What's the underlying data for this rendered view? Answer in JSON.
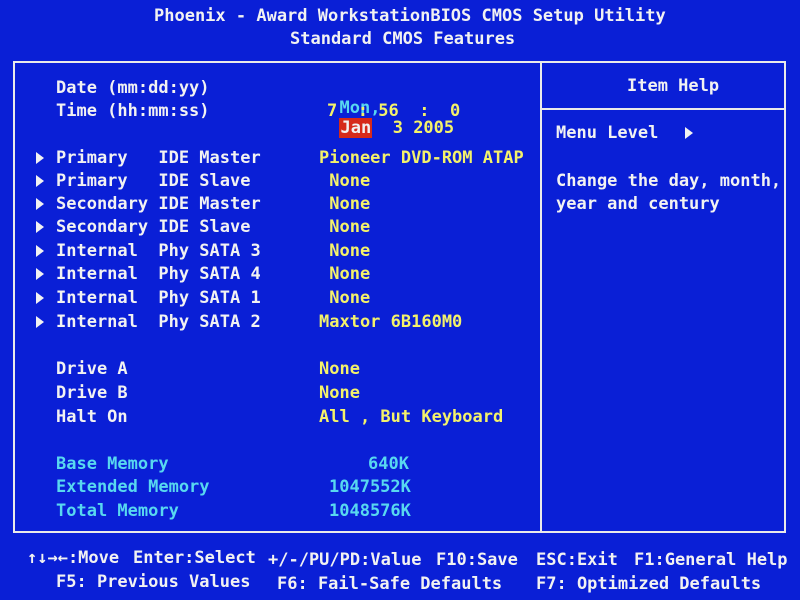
{
  "header": {
    "title": "Phoenix - Award WorkstationBIOS CMOS Setup Utility",
    "subtitle": "Standard CMOS Features"
  },
  "datetime": {
    "date_label": "Date (mm:dd:yy)",
    "time_label": "Time (hh:mm:ss)",
    "day": "Mon,",
    "month": "Jan",
    "day_num": "3",
    "year": "2005",
    "hour": "7",
    "sep1": ":",
    "minute": "56",
    "sep2": ":",
    "second": "0"
  },
  "ide_devices": [
    {
      "name": "Primary   IDE Master",
      "value": "Pioneer DVD-ROM ATAP"
    },
    {
      "name": "Primary   IDE Slave",
      "value": " None"
    },
    {
      "name": "Secondary IDE Master",
      "value": " None"
    },
    {
      "name": "Secondary IDE Slave",
      "value": " None"
    },
    {
      "name": "Internal  Phy SATA 3",
      "value": " None"
    },
    {
      "name": "Internal  Phy SATA 4",
      "value": " None"
    },
    {
      "name": "Internal  Phy SATA 1",
      "value": " None"
    },
    {
      "name": "Internal  Phy SATA 2",
      "value": "Maxtor 6B160M0"
    }
  ],
  "drives": [
    {
      "name": "Drive A",
      "value": "None"
    },
    {
      "name": "Drive B",
      "value": "None"
    },
    {
      "name": "Halt On",
      "value": "All , But Keyboard"
    }
  ],
  "memory": [
    {
      "name": "Base Memory",
      "value": "640K"
    },
    {
      "name": "Extended Memory",
      "value": "1047552K"
    },
    {
      "name": "Total Memory",
      "value": "1048576K"
    }
  ],
  "help": {
    "title": "Item Help",
    "menu_level": "Menu Level",
    "line1": "Change the day, month,",
    "line2": "year and century"
  },
  "footer": {
    "move_keys": "↑↓→←:Move",
    "enter": "Enter:Select",
    "value": "+/-/PU/PD:Value",
    "f10": "F10:Save",
    "esc": "ESC:Exit",
    "f1": "F1:General Help",
    "f5": "F5: Previous Values",
    "f6": "F6: Fail-Safe Defaults",
    "f7": "F7: Optimized Defaults"
  },
  "colors": {
    "background": "#0a1fd6",
    "text": "#f2f2f2",
    "value": "#f4f26a",
    "info": "#58d8f0",
    "highlight": "#d62a1a"
  }
}
